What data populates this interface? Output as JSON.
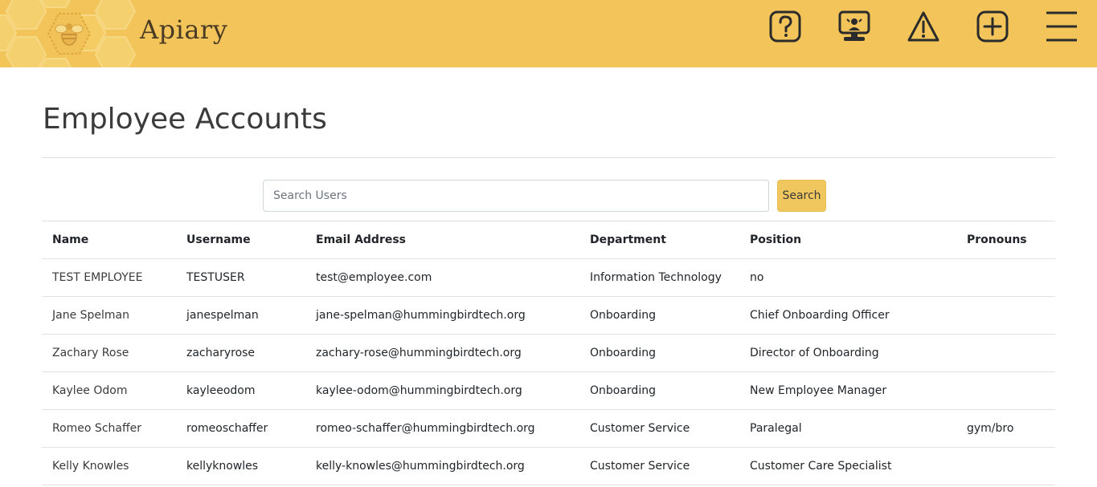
{
  "app": {
    "title": "Apiary"
  },
  "nav": {
    "icons": [
      {
        "name": "help-icon"
      },
      {
        "name": "kiosk-icon"
      },
      {
        "name": "warning-icon"
      },
      {
        "name": "add-icon"
      },
      {
        "name": "menu-icon"
      }
    ]
  },
  "colors": {
    "navbar": "#f2c45a",
    "search_button": "#f0c75e",
    "brand_text": "#4a3b24"
  },
  "page": {
    "title": "Employee Accounts"
  },
  "search": {
    "placeholder": "Search Users",
    "value": "",
    "button_label": "Search"
  },
  "table": {
    "headers": [
      "Name",
      "Username",
      "Email Address",
      "Department",
      "Position",
      "Pronouns"
    ],
    "rows": [
      [
        "TEST EMPLOYEE",
        "TESTUSER",
        "test@employee.com",
        "Information Technology",
        "no",
        ""
      ],
      [
        "Jane Spelman",
        "janespelman",
        "jane-spelman@hummingbirdtech.org",
        "Onboarding",
        "Chief Onboarding Officer",
        ""
      ],
      [
        "Zachary Rose",
        "zacharyrose",
        "zachary-rose@hummingbirdtech.org",
        "Onboarding",
        "Director of Onboarding",
        ""
      ],
      [
        "Kaylee Odom",
        "kayleeodom",
        "kaylee-odom@hummingbirdtech.org",
        "Onboarding",
        "New Employee Manager",
        ""
      ],
      [
        "Romeo Schaffer",
        "romeoschaffer",
        "romeo-schaffer@hummingbirdtech.org",
        "Customer Service",
        "Paralegal",
        "gym/bro"
      ],
      [
        "Kelly Knowles",
        "kellyknowles",
        "kelly-knowles@hummingbirdtech.org",
        "Customer Service",
        "Customer Care Specialist",
        ""
      ]
    ]
  }
}
